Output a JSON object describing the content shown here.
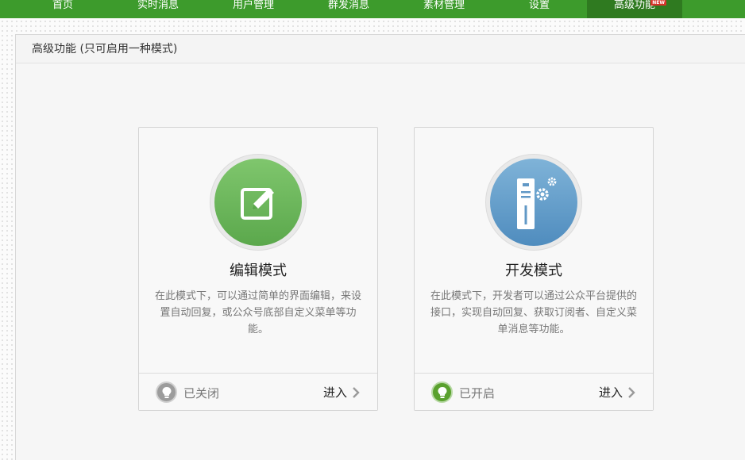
{
  "nav": {
    "items": [
      {
        "label": "首页"
      },
      {
        "label": "实时消息"
      },
      {
        "label": "用户管理"
      },
      {
        "label": "群发消息"
      },
      {
        "label": "素材管理"
      },
      {
        "label": "设置"
      },
      {
        "label": "高级功能",
        "badge": "NEW",
        "active": true
      }
    ]
  },
  "panel": {
    "title": "高级功能 (只可启用一种模式)"
  },
  "cards": [
    {
      "title": "编辑模式",
      "description": "在此模式下，可以通过简单的界面编辑，来设置自动回复，或公众号底部自定义菜单等功能。",
      "status": "已关闭",
      "enter": "进入",
      "icon": "edit-icon"
    },
    {
      "title": "开发模式",
      "description": "在此模式下，开发者可以通过公众平台提供的接口，实现自动回复、获取订阅者、自定义菜单消息等功能。",
      "status": "已开启",
      "enter": "进入",
      "icon": "server-gear-icon"
    }
  ],
  "colors": {
    "nav_bg": "#3d9b2c",
    "nav_active": "#2f7a20",
    "edit_green": "#6ab85a",
    "dev_blue": "#6198c6",
    "status_on": "#5aa12e",
    "status_off": "#9c9c9c"
  }
}
